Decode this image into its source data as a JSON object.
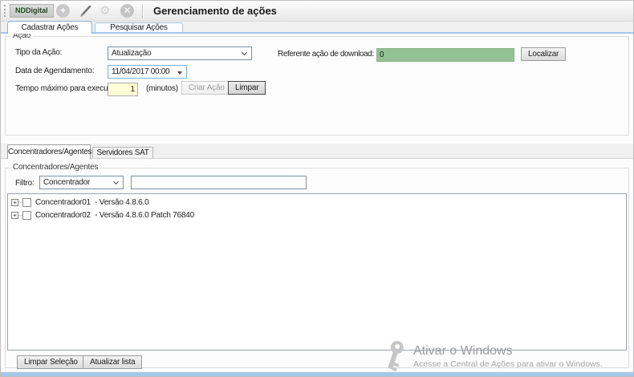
{
  "header": {
    "brand": "NDDigital",
    "title": "Gerenciamento de ações"
  },
  "icons": {
    "add_glyph": "+",
    "close_glyph": "✕",
    "gear_glyph": "⚙",
    "expand_glyph": "+"
  },
  "main_tabs": {
    "cadastrar": "Cadastrar Ações",
    "pesquisar": "Pesquisar Ações"
  },
  "acao": {
    "group_title": "Ação",
    "tipo_label": "Tipo da Ação:",
    "tipo_value": "Atualização",
    "data_label": "Data de Agendamento:",
    "data_value": "11/04/2017 00:00",
    "tempo_label": "Tempo máximo para execução:",
    "tempo_value": "1",
    "tempo_unit": "(minutos)",
    "criar_label": "Criar Ação",
    "limpar_label": "Limpar",
    "referente_label": "Referente ação de download:",
    "referente_value": "0",
    "localizar_label": "Localizar"
  },
  "lower_tabs": {
    "concentradores": "Concentradores/Agentes",
    "servidores": "Servidores SAT"
  },
  "concentradores": {
    "group_title": "Concentradores/Agentes",
    "filtro_label": "Filtro:",
    "filtro_value": "Concentrador",
    "filtro_input_value": "",
    "tree_items": [
      {
        "label": "Concentrador01  - Versão 4.8.6.0",
        "checked": false
      },
      {
        "label": "Concentrador02  - Versão 4.8.6.0 Patch 76840",
        "checked": false
      }
    ],
    "limpar_selecao_label": "Limpar Seleção",
    "atualizar_lista_label": "Atualizar lista"
  },
  "watermark": {
    "line1": "Ativar o Windows",
    "line2": "Acesse a Central de Ações para ativar o Windows."
  },
  "colors": {
    "referente_bg": "#94c294",
    "tempo_bg": "#ffffd7",
    "tab_line_blue": "#a2c6ec",
    "bottom_strip_blue": "#a6c8e8",
    "date_border_blue": "#7eb4ea"
  }
}
